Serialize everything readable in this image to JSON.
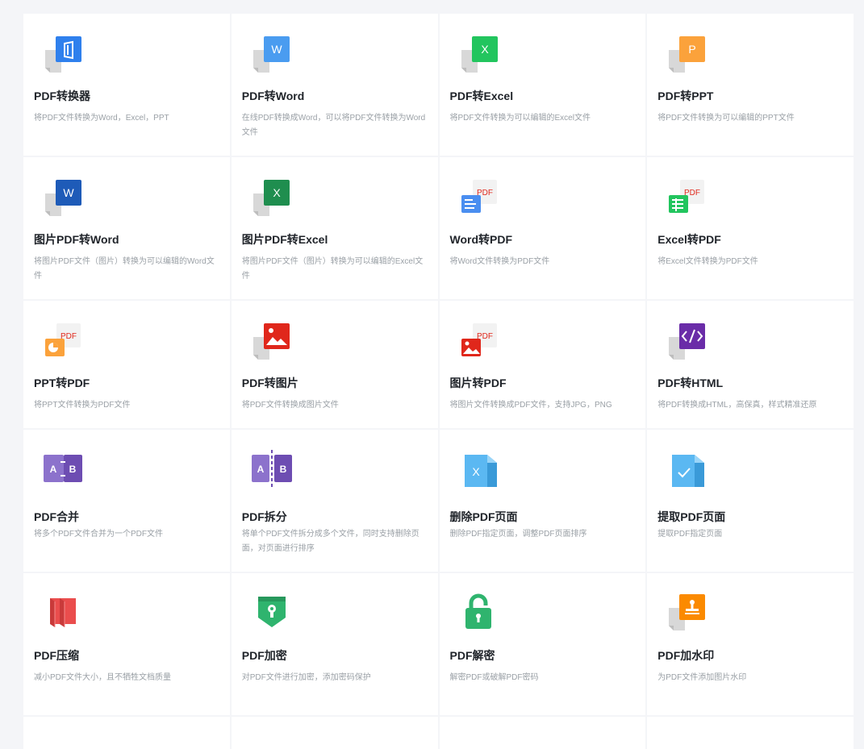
{
  "tools": [
    {
      "name": "PDF转换器",
      "desc": "将PDF文件转换为Word，Excel，PPT",
      "icon": "office-convert-icon",
      "color": "#2f80ed"
    },
    {
      "name": "PDF转Word",
      "desc": "在线PDF转换成Word，可以将PDF文件转换为Word文件",
      "icon": "word-doc-icon",
      "color": "#4a9cf0",
      "glyph": "W"
    },
    {
      "name": "PDF转Excel",
      "desc": "将PDF文件转换为可以编辑的Excel文件",
      "icon": "excel-doc-icon",
      "color": "#22c55e",
      "glyph": "X"
    },
    {
      "name": "PDF转PPT",
      "desc": "将PDF文件转换为可以编辑的PPT文件",
      "icon": "ppt-doc-icon",
      "color": "#fba23b",
      "glyph": "P"
    },
    {
      "name": "图片PDF转Word",
      "desc": "将图片PDF文件（图片）转换为可以编辑的Word文件",
      "icon": "image-to-word-icon",
      "color": "#1e5bb8",
      "glyph": "W"
    },
    {
      "name": "图片PDF转Excel",
      "desc": "将图片PDF文件（图片）转换为可以编辑的Excel文件",
      "icon": "image-to-excel-icon",
      "color": "#1f8e4f",
      "glyph": "X"
    },
    {
      "name": "Word转PDF",
      "desc": "将Word文件转换为PDF文件",
      "icon": "word-to-pdf-icon",
      "color": "#4a8ef0",
      "glyph": "PDF"
    },
    {
      "name": "Excel转PDF",
      "desc": "将Excel文件转换为PDF文件",
      "icon": "excel-to-pdf-icon",
      "color": "#22c55e",
      "glyph": "PDF"
    },
    {
      "name": "PPT转PDF",
      "desc": "将PPT文件转换为PDF文件",
      "icon": "ppt-to-pdf-icon",
      "color": "#fba23b",
      "glyph": "PDF"
    },
    {
      "name": "PDF转图片",
      "desc": "将PDF文件转换成图片文件",
      "icon": "pdf-to-image-icon",
      "color": "#e0271b"
    },
    {
      "name": "图片转PDF",
      "desc": "将图片文件转换成PDF文件，支持JPG，PNG",
      "icon": "image-to-pdf-icon",
      "color": "#e0271b",
      "glyph": "PDF"
    },
    {
      "name": "PDF转HTML",
      "desc": "将PDF转换成HTML，高保真，样式精准还原",
      "icon": "code-icon",
      "color": "#6a2ca8"
    },
    {
      "name": "PDF合并",
      "desc": "将多个PDF文件合并为一个PDF文件",
      "icon": "merge-icon",
      "color": "#7b5fbf",
      "glyph_a": "A",
      "glyph_b": "B"
    },
    {
      "name": "PDF拆分",
      "desc": "将单个PDF文件拆分成多个文件，同时支持删除页面，对页面进行排序",
      "icon": "split-icon",
      "color": "#7b5fbf",
      "glyph_a": "A",
      "glyph_b": "B"
    },
    {
      "name": "删除PDF页面",
      "desc": "删除PDF指定页面，调整PDF页面排序",
      "icon": "delete-page-icon",
      "color": "#5bb8f2",
      "glyph": "X"
    },
    {
      "name": "提取PDF页面",
      "desc": "提取PDF指定页面",
      "icon": "extract-page-icon",
      "color": "#5bb8f2"
    },
    {
      "name": "PDF压缩",
      "desc": "减小PDF文件大小，且不牺牲文档质量",
      "icon": "compress-icon",
      "color": "#ea4d4d"
    },
    {
      "name": "PDF加密",
      "desc": "对PDF文件进行加密，添加密码保护",
      "icon": "shield-lock-icon",
      "color": "#2fb46e"
    },
    {
      "name": "PDF解密",
      "desc": "解密PDF或破解PDF密码",
      "icon": "unlock-icon",
      "color": "#2fb46e"
    },
    {
      "name": "PDF加水印",
      "desc": "为PDF文件添加图片水印",
      "icon": "stamp-icon",
      "color": "#fb8a00"
    }
  ]
}
